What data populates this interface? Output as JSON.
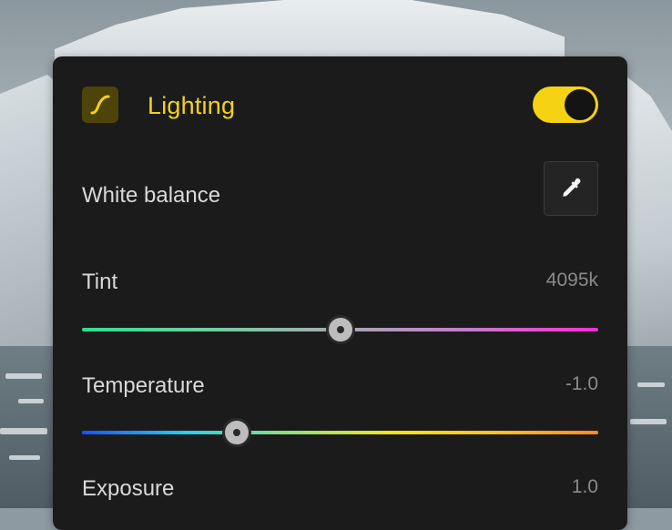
{
  "panel": {
    "title": "Lighting",
    "toggle_on": true,
    "icon": "curve-icon",
    "accent_color": "#f6d214",
    "white_balance": {
      "label": "White balance",
      "button_icon": "eyedropper-icon"
    },
    "tint": {
      "label": "Tint",
      "value": "4095k",
      "position": 0.5
    },
    "temperature": {
      "label": "Temperature",
      "value": "-1.0",
      "position": 0.3
    },
    "exposure": {
      "label": "Exposure",
      "value": "1.0"
    }
  }
}
